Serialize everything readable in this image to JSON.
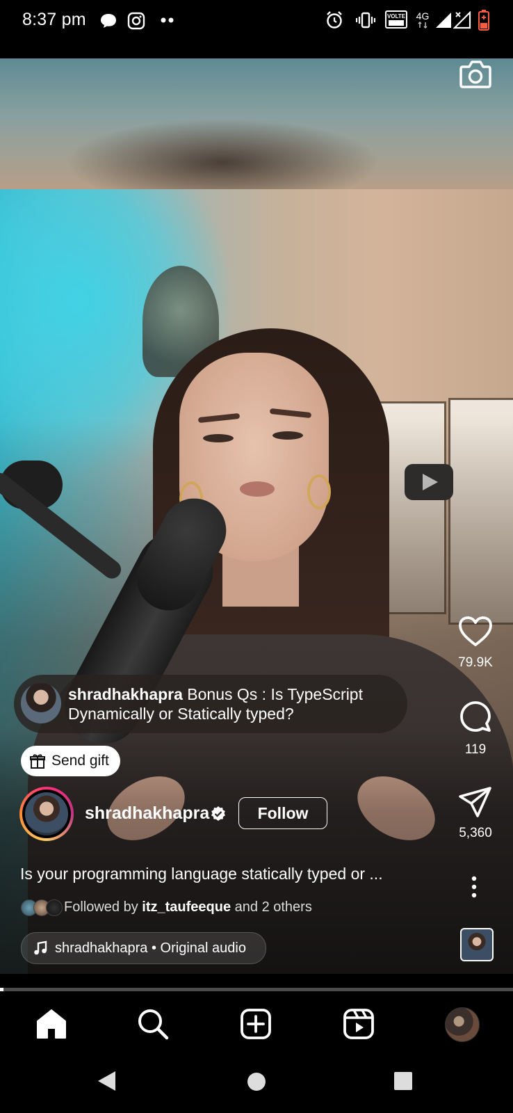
{
  "status_bar": {
    "time": "8:37 pm",
    "icons": [
      "chat-bubble-icon",
      "instagram-icon",
      "more-dots-icon",
      "alarm-icon",
      "vibrate-icon",
      "volte-icon",
      "4g-icon",
      "signal-icon",
      "signal-x-icon",
      "battery-low-icon"
    ]
  },
  "reel": {
    "actions": {
      "likes": "79.9K",
      "comments": "119",
      "shares": "5,360"
    },
    "caption_bubble": {
      "username": "shradhakhapra",
      "text": " Bonus Qs : Is TypeScript Dynamically or Statically typed?"
    },
    "gift_label": "Send gift",
    "author": {
      "username": "shradhakhapra",
      "verified": true,
      "follow_label": "Follow"
    },
    "description": "Is your programming language statically typed or ...",
    "followed_by": {
      "prefix": "Followed by ",
      "user": "itz_taufeeque",
      "suffix": " and 2 others"
    },
    "audio": "shradhakhapra • Original audio",
    "progress": 0.007
  },
  "bottom_nav": {
    "items": [
      "home-icon",
      "search-icon",
      "create-icon",
      "reels-icon",
      "profile-avatar"
    ]
  },
  "colors": {
    "background": "#000000",
    "text": "#ffffff",
    "follow_border": "#ffffff"
  }
}
